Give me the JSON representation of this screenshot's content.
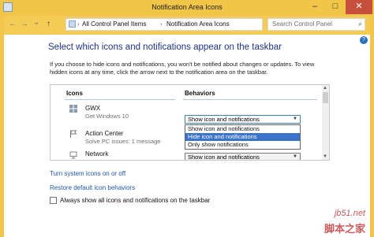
{
  "window": {
    "title": "Notification Area Icons",
    "controls": {
      "minimize": "–",
      "maximize": "□",
      "close": "✕"
    }
  },
  "addressbar": {
    "nav": {
      "back": "←",
      "forward": "→",
      "history": "⌄",
      "up": "↑"
    },
    "breadcrumbs": [
      "All Control Panel Items",
      "Notification Area Icons"
    ],
    "separator": "›",
    "search_placeholder": "Search Control Panel"
  },
  "content": {
    "heading": "Select which icons and notifications appear on the taskbar",
    "description": "If you choose to hide icons and notifications, you won't be notified about changes or updates. To view hidden icons at any time, click the arrow next to the notification area on the taskbar.",
    "table": {
      "col_icons": "Icons",
      "col_behaviors": "Behaviors",
      "rows": [
        {
          "name": "GWX",
          "sub": "Get Windows 10",
          "behavior": "Show icon and notifications",
          "icon": "windows-icon"
        },
        {
          "name": "Action Center",
          "sub": "Solve PC issues: 1 message",
          "behavior": "",
          "icon": "flag-icon"
        },
        {
          "name": "Network",
          "sub": "",
          "behavior": "Show icon and notifications",
          "icon": "network-icon"
        }
      ],
      "dropdown_options": [
        "Show icon and notifications",
        "Hide icon and notifications",
        "Only show notifications"
      ],
      "selected_option_index": 1
    },
    "links": {
      "system_icons": "Turn system icons on or off",
      "restore": "Restore default icon behaviors"
    },
    "checkbox_label": "Always show all icons and notifications on the taskbar",
    "checkbox_checked": false,
    "watermark": {
      "line1": "jb51.net",
      "line2": "脚本之家"
    }
  }
}
